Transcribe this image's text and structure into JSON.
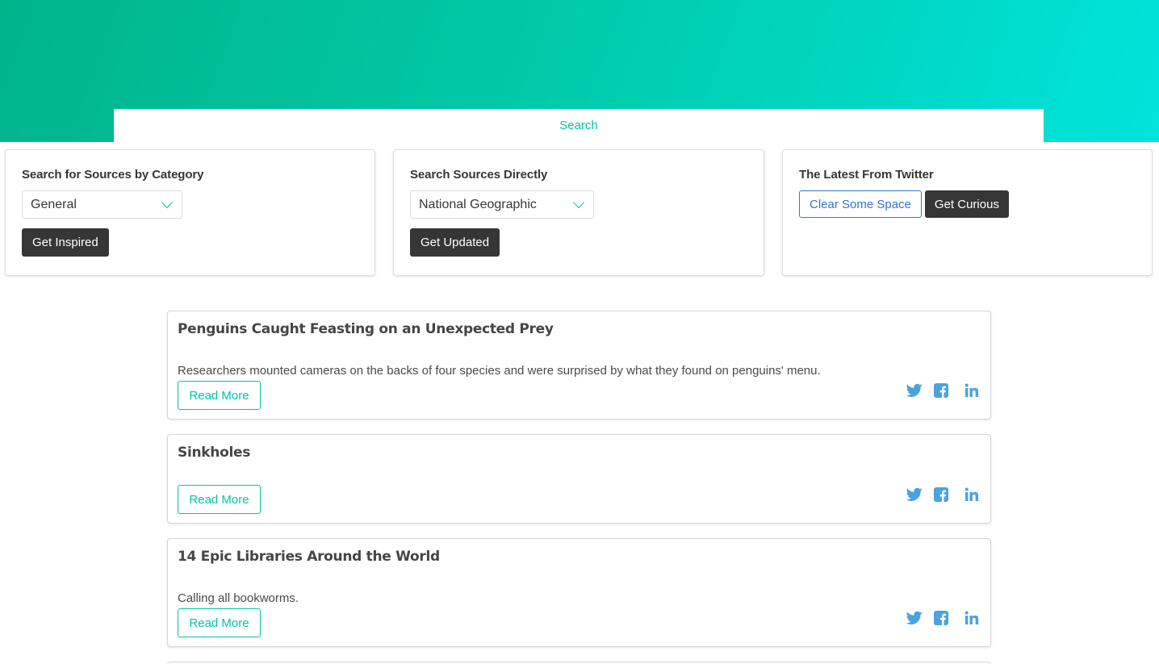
{
  "nav": {
    "search_tab": "Search"
  },
  "panels": {
    "category": {
      "title": "Search for Sources by Category",
      "selected": "General",
      "button": "Get Inspired"
    },
    "sources": {
      "title": "Search Sources Directly",
      "selected": "National Geographic",
      "button": "Get Updated"
    },
    "twitter": {
      "title": "The Latest From Twitter",
      "clear_button": "Clear Some Space",
      "curious_button": "Get Curious"
    }
  },
  "articles": [
    {
      "title": "Penguins Caught Feasting on an Unexpected Prey",
      "description": "Researchers mounted cameras on the backs of four species and were surprised by what they found on penguins' menu.",
      "read_more": "Read More"
    },
    {
      "title": "Sinkholes",
      "description": "",
      "read_more": "Read More"
    },
    {
      "title": "14 Epic Libraries Around the World",
      "description": "Calling all bookworms.",
      "read_more": "Read More"
    }
  ],
  "icons": {
    "twitter": "twitter-icon",
    "facebook": "facebook-icon",
    "linkedin": "linkedin-icon"
  },
  "colors": {
    "accent": "#00c4a7",
    "social": "#4aa3df",
    "dark_button": "#363636",
    "link_blue": "#3273dc"
  }
}
